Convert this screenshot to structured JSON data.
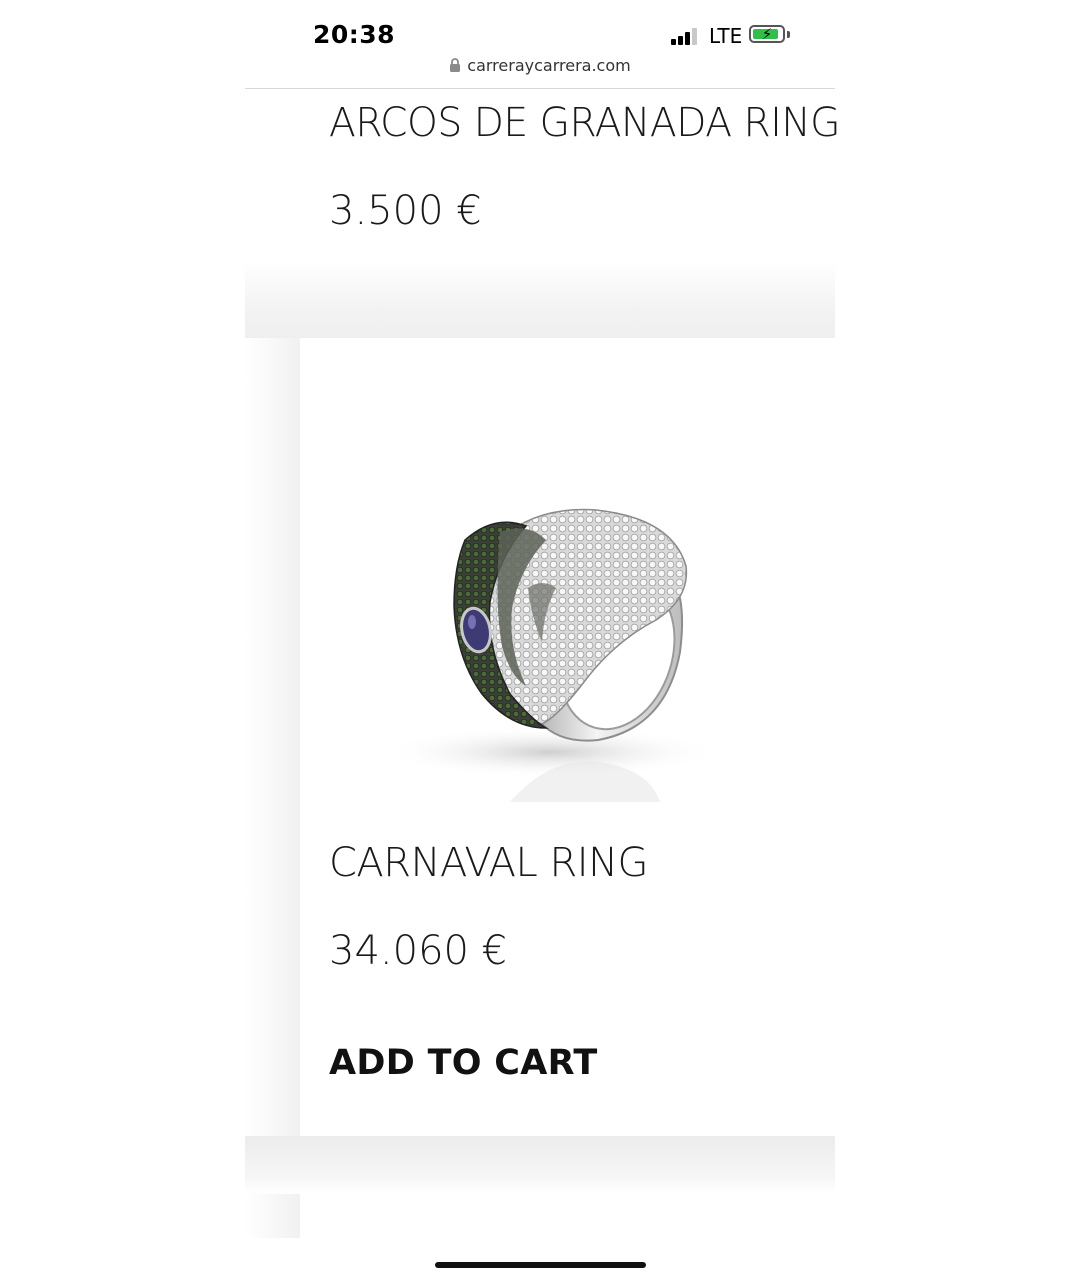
{
  "status_bar": {
    "time": "20:38",
    "network": "LTE",
    "battery_level": 0.9,
    "battery_charging": true,
    "signal_bars": 3
  },
  "browser": {
    "url": "carreraycarrera.com",
    "lock_icon": "lock-icon"
  },
  "products": [
    {
      "name": "ARCOS DE GRANADA RING",
      "price": "3.500 €"
    },
    {
      "name": "CARNAVAL RING",
      "price": "34.060 €",
      "cta": "ADD TO CART"
    }
  ],
  "colors": {
    "background": "#ffffff",
    "text": "#1a1a1a",
    "battery_fill": "#2fbf4a"
  }
}
